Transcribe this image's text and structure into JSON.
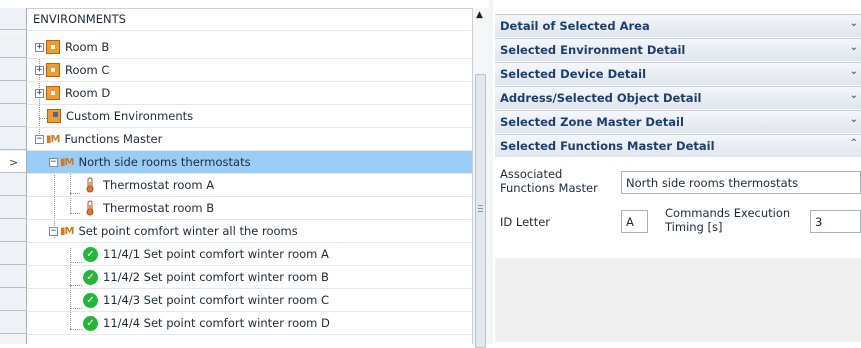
{
  "tree": {
    "header": "ENVIRONMENTS",
    "items": [
      {
        "label": "Room B",
        "icon": "room-icon",
        "expander": "+"
      },
      {
        "label": "Room C",
        "icon": "room-icon",
        "expander": "+"
      },
      {
        "label": "Room D",
        "icon": "room-icon",
        "expander": "+"
      },
      {
        "label": "Custom Environments",
        "icon": "custom-environment-icon"
      },
      {
        "label": "Functions Master",
        "icon": "functions-master-icon",
        "expander": "−"
      },
      {
        "label": "North side rooms thermostats",
        "icon": "functions-master-icon",
        "expander": "−",
        "selected": true
      },
      {
        "label": "Thermostat room A",
        "icon": "thermostat-icon"
      },
      {
        "label": "Thermostat room B",
        "icon": "thermostat-icon"
      },
      {
        "label": "Set point comfort winter all the rooms",
        "icon": "functions-master-icon",
        "expander": "−"
      },
      {
        "label": "11/4/1 Set point comfort winter room A",
        "icon": "check-icon"
      },
      {
        "label": "11/4/2 Set point comfort winter room B",
        "icon": "check-icon"
      },
      {
        "label": "11/4/3 Set point comfort winter room C",
        "icon": "check-icon"
      },
      {
        "label": "11/4/4 Set point comfort winter room D",
        "icon": "check-icon"
      }
    ],
    "current_row_marker": ">",
    "fm_icon_text": "M"
  },
  "details": {
    "sections": [
      {
        "title": "Detail of Selected Area",
        "chevron": "⌄"
      },
      {
        "title": "Selected Environment Detail",
        "chevron": "⌄"
      },
      {
        "title": "Selected Device Detail",
        "chevron": "⌄"
      },
      {
        "title": "Address/Selected Object Detail",
        "chevron": "⌄"
      },
      {
        "title": "Selected Zone Master Detail",
        "chevron": "⌄"
      },
      {
        "title": "Selected Functions Master Detail",
        "chevron": "⌃"
      }
    ],
    "assoc_label_1": "Associated",
    "assoc_label_2": "Functions Master",
    "assoc_value": "North side rooms thermostats",
    "id_letter_label": "ID Letter",
    "id_letter_value": "A",
    "timing_label_1": "Commands Execution",
    "timing_label_2": "Timing [s]",
    "timing_value": "3"
  },
  "colors": {
    "selection": "#99cdf6",
    "room_icon": "#f39a2a",
    "check": "#23b63a",
    "section_title": "#1c3f6e"
  }
}
